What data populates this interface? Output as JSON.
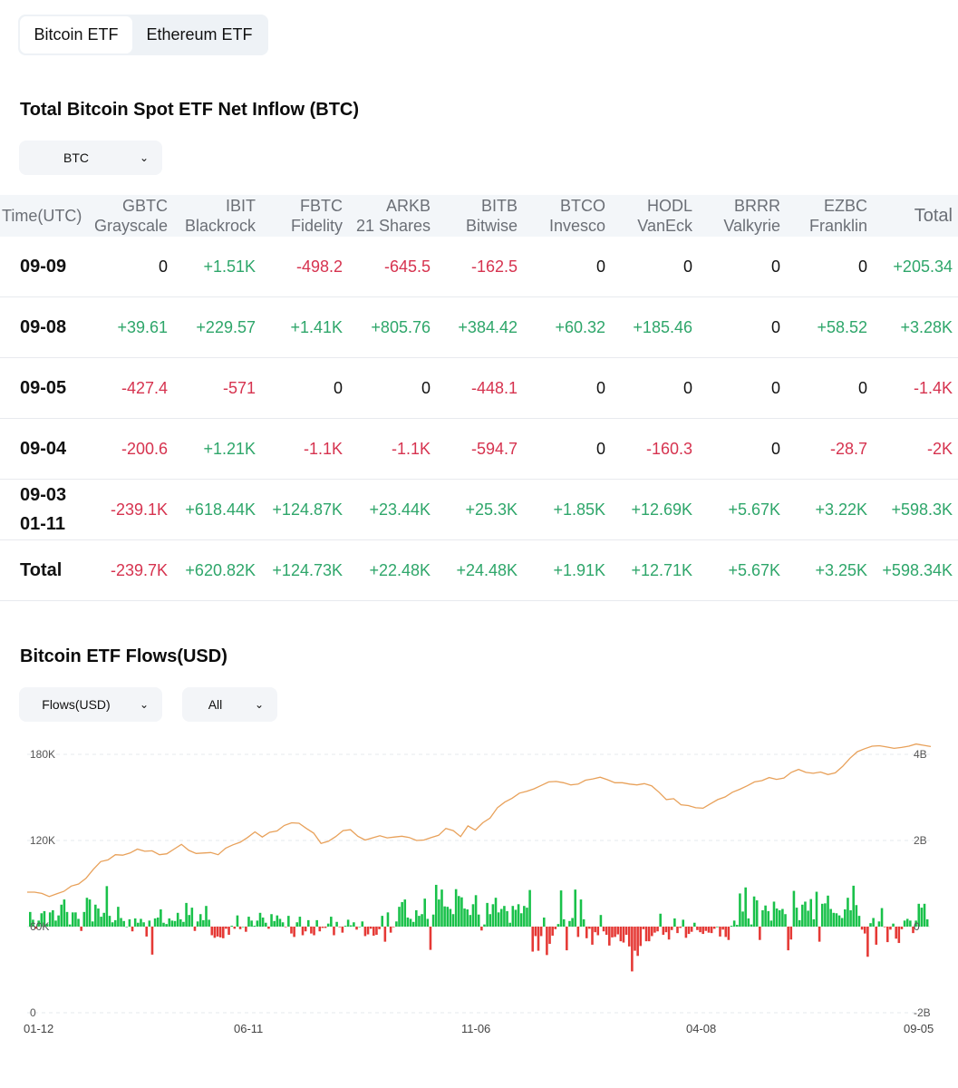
{
  "tabs": [
    {
      "label": "Bitcoin ETF",
      "active": true
    },
    {
      "label": "Ethereum ETF",
      "active": false
    }
  ],
  "net_inflow": {
    "title": "Total Bitcoin Spot ETF Net Inflow (BTC)",
    "unit_select": "BTC",
    "columns": [
      {
        "ticker": "Time(UTC)",
        "name": ""
      },
      {
        "ticker": "GBTC",
        "name": "Grayscale"
      },
      {
        "ticker": "IBIT",
        "name": "Blackrock"
      },
      {
        "ticker": "FBTC",
        "name": "Fidelity"
      },
      {
        "ticker": "ARKB",
        "name": "21 Shares"
      },
      {
        "ticker": "BITB",
        "name": "Bitwise"
      },
      {
        "ticker": "BTCO",
        "name": "Invesco"
      },
      {
        "ticker": "HODL",
        "name": "VanEck"
      },
      {
        "ticker": "BRRR",
        "name": "Valkyrie"
      },
      {
        "ticker": "EZBC",
        "name": "Franklin"
      },
      {
        "ticker": "Total",
        "name": ""
      }
    ],
    "rows": [
      {
        "label": "09-09",
        "values": [
          "0",
          "+1.51K",
          "-498.2",
          "-645.5",
          "-162.5",
          "0",
          "0",
          "0",
          "0",
          "+205.34"
        ]
      },
      {
        "label": "09-08",
        "values": [
          "+39.61",
          "+229.57",
          "+1.41K",
          "+805.76",
          "+384.42",
          "+60.32",
          "+185.46",
          "0",
          "+58.52",
          "+3.28K"
        ]
      },
      {
        "label": "09-05",
        "values": [
          "-427.4",
          "-571",
          "0",
          "0",
          "-448.1",
          "0",
          "0",
          "0",
          "0",
          "-1.4K"
        ]
      },
      {
        "label": "09-04",
        "values": [
          "-200.6",
          "+1.21K",
          "-1.1K",
          "-1.1K",
          "-594.7",
          "0",
          "-160.3",
          "0",
          "-28.7",
          "-2K"
        ]
      },
      {
        "label": "09-03\n01-11",
        "values": [
          "-239.1K",
          "+618.44K",
          "+124.87K",
          "+23.44K",
          "+25.3K",
          "+1.85K",
          "+12.69K",
          "+5.67K",
          "+3.22K",
          "+598.3K"
        ]
      },
      {
        "label": "Total",
        "values": [
          "-239.7K",
          "+620.82K",
          "+124.73K",
          "+22.48K",
          "+24.48K",
          "+1.91K",
          "+12.71K",
          "+5.67K",
          "+3.25K",
          "+598.34K"
        ]
      }
    ]
  },
  "flows": {
    "title": "Bitcoin ETF Flows(USD)",
    "metric_select": "Flows(USD)",
    "range_select": "All"
  },
  "colors": {
    "positive": "#2ea66a",
    "negative": "#d6334f",
    "bar_up": "#19c14a",
    "bar_down": "#e53935",
    "line": "#e8a15a"
  },
  "chart_data": {
    "type": "bar",
    "left_axis": {
      "ticks": [
        "180K",
        "120K",
        "60K",
        "0"
      ],
      "range": [
        0,
        180000
      ]
    },
    "right_axis": {
      "ticks": [
        "4B",
        "2B",
        "0",
        "-2B"
      ],
      "range": [
        -2,
        4
      ],
      "unit": "B"
    },
    "x_ticks": [
      "01-12",
      "06-11",
      "11-06",
      "04-08",
      "09-05"
    ],
    "grid": true,
    "series": [
      {
        "type": "bar",
        "values": [
          0.34,
          0.16,
          -0.05,
          0.14,
          0.31,
          0.36,
          0.06,
          0.33,
          0.38,
          0.14,
          0.26,
          0.51,
          0.63,
          0.34,
          0.05,
          0.33,
          0.33,
          0.18,
          -0.1,
          0.34,
          0.67,
          0.63,
          0.12,
          0.51,
          0.42,
          0.23,
          0.32,
          0.94,
          0.25,
          0.1,
          0.15,
          0.46,
          0.2,
          0.13,
          0.0,
          0.17,
          -0.11,
          0.19,
          0.09,
          0.18,
          0.1,
          -0.23,
          0.14,
          -0.65,
          0.19,
          0.21,
          0.4,
          0.09,
          0.06,
          0.19,
          0.14,
          0.13,
          0.32,
          0.17,
          0.11,
          0.55,
          0.27,
          0.44,
          -0.1,
          0.12,
          0.29,
          0.15,
          0.48,
          0.16,
          -0.2,
          -0.26,
          -0.23,
          -0.25,
          -0.27,
          -0.05,
          -0.19,
          0.02,
          -0.05,
          0.26,
          -0.06,
          -0.0,
          -0.12,
          0.23,
          0.14,
          0.02,
          0.14,
          0.32,
          0.21,
          0.09,
          -0.05,
          0.29,
          0.13,
          0.26,
          0.18,
          0.1,
          -0.01,
          0.25,
          -0.16,
          -0.24,
          0.1,
          0.23,
          -0.2,
          -0.11,
          0.15,
          -0.16,
          -0.2,
          0.15,
          -0.11,
          -0.03,
          -0.03,
          0.07,
          0.23,
          -0.2,
          0.11,
          -0.01,
          -0.14,
          0.02,
          0.16,
          0.03,
          0.1,
          -0.07,
          0.0,
          0.12,
          -0.22,
          -0.18,
          -0.05,
          -0.21,
          -0.19,
          -0.06,
          0.25,
          -0.35,
          0.33,
          -0.14,
          -0.01,
          0.12,
          0.46,
          0.57,
          0.63,
          0.21,
          0.18,
          0.11,
          0.38,
          0.25,
          0.29,
          0.65,
          0.18,
          -0.54,
          0.28,
          0.97,
          0.63,
          0.86,
          0.47,
          0.46,
          0.41,
          0.29,
          0.87,
          0.71,
          0.68,
          0.42,
          0.4,
          0.27,
          0.52,
          0.73,
          0.28,
          -0.09,
          0.05,
          0.55,
          0.29,
          0.52,
          0.67,
          0.33,
          0.41,
          0.48,
          0.36,
          0.09,
          0.48,
          0.39,
          0.52,
          0.31,
          0.48,
          0.44,
          0.85,
          -0.58,
          -0.22,
          -0.56,
          -0.22,
          0.21,
          -0.66,
          -0.4,
          -0.21,
          -0.06,
          0.06,
          0.84,
          0.17,
          -0.55,
          0.13,
          0.2,
          0.86,
          -0.24,
          0.63,
          0.17,
          -0.27,
          -0.05,
          -0.42,
          -0.13,
          -0.2,
          0.27,
          -0.11,
          -0.19,
          -0.44,
          -0.25,
          -0.24,
          -0.18,
          -0.34,
          -0.37,
          -0.19,
          -0.46,
          -1.04,
          -0.56,
          -0.68,
          -0.45,
          -0.06,
          -0.34,
          -0.34,
          -0.22,
          -0.14,
          -0.11,
          0.3,
          -0.19,
          -0.13,
          -0.3,
          -0.08,
          0.19,
          -0.15,
          -0.03,
          0.16,
          -0.26,
          -0.17,
          -0.12,
          0.09,
          -0.08,
          -0.13,
          -0.17,
          -0.1,
          -0.14,
          -0.15,
          -0.05,
          -0.0,
          -0.23,
          -0.07,
          -0.24,
          -0.31,
          0.02,
          0.14,
          0.04,
          0.77,
          0.35,
          0.91,
          0.19,
          0.05,
          0.7,
          0.61,
          -0.31,
          0.38,
          0.49,
          0.36,
          0.14,
          0.58,
          0.42,
          0.38,
          0.41,
          0.29,
          -0.55,
          -0.3,
          0.83,
          0.44,
          0.15,
          0.51,
          0.58,
          0.37,
          0.64,
          0.17,
          0.81,
          -0.35,
          0.53,
          0.54,
          0.72,
          0.41,
          0.32,
          0.31,
          0.26,
          0.2,
          0.4,
          0.67,
          0.38,
          0.95,
          0.5,
          0.25,
          -0.07,
          -0.16,
          -0.7,
          0.08,
          0.2,
          -0.42,
          0.12,
          0.43,
          -0.01,
          -0.36,
          -0.07,
          0.07,
          -0.28,
          -0.38,
          -0.06,
          0.14,
          0.18,
          0.14,
          -0.15,
          0.14,
          0.53,
          0.44,
          0.53,
          0.17
        ]
      },
      {
        "type": "line",
        "values": [
          0.8,
          0.8,
          0.77,
          0.7,
          0.76,
          0.82,
          0.94,
          0.99,
          1.12,
          1.33,
          1.51,
          1.55,
          1.67,
          1.66,
          1.71,
          1.8,
          1.75,
          1.76,
          1.67,
          1.69,
          1.8,
          1.91,
          1.77,
          1.7,
          1.71,
          1.72,
          1.67,
          1.82,
          1.9,
          1.96,
          2.07,
          2.2,
          2.08,
          2.19,
          2.22,
          2.35,
          2.41,
          2.4,
          2.28,
          2.17,
          1.93,
          1.98,
          2.09,
          2.23,
          2.25,
          2.1,
          2.01,
          2.06,
          2.11,
          2.06,
          2.08,
          2.1,
          2.07,
          2.0,
          2.01,
          2.07,
          2.12,
          2.28,
          2.23,
          2.09,
          2.34,
          2.24,
          2.41,
          2.52,
          2.76,
          2.89,
          2.98,
          3.1,
          3.14,
          3.2,
          3.28,
          3.36,
          3.37,
          3.34,
          3.29,
          3.31,
          3.4,
          3.43,
          3.47,
          3.41,
          3.34,
          3.34,
          3.31,
          3.29,
          3.32,
          3.27,
          3.12,
          2.95,
          2.97,
          2.83,
          2.81,
          2.76,
          2.75,
          2.85,
          2.95,
          3.01,
          3.12,
          3.19,
          3.27,
          3.36,
          3.39,
          3.46,
          3.42,
          3.45,
          3.58,
          3.65,
          3.58,
          3.56,
          3.59,
          3.53,
          3.57,
          3.72,
          3.91,
          4.06,
          4.13,
          4.19,
          4.2,
          4.17,
          4.14,
          4.16,
          4.19,
          4.24,
          4.21,
          4.18
        ]
      }
    ]
  }
}
